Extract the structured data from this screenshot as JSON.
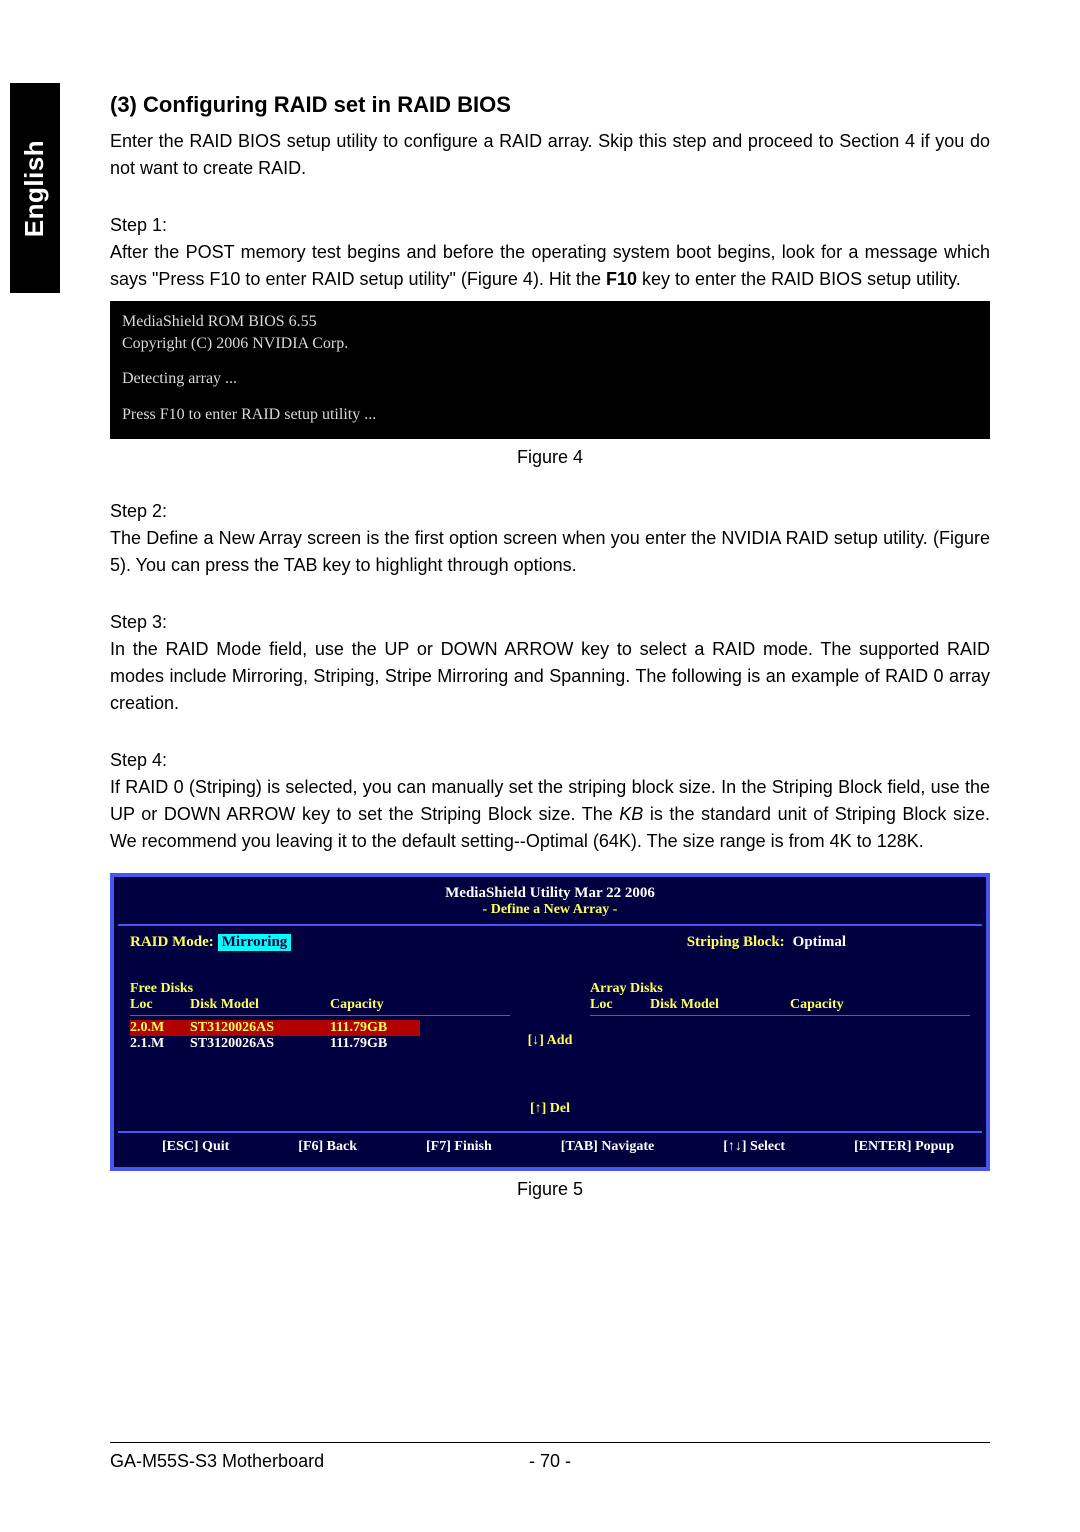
{
  "side_tab": "English",
  "section": {
    "heading": "(3) Configuring RAID set in RAID BIOS",
    "intro": "Enter the RAID BIOS setup utility to configure a RAID array. Skip this step and proceed to Section 4 if you do not want to create RAID."
  },
  "step1": {
    "label": "Step 1:",
    "text_a": "After the POST memory test begins and before the operating system boot begins, look for a message which says \"Press F10 to enter RAID setup utility\" (Figure 4). Hit the ",
    "key": "F10",
    "text_b": " key to enter the RAID BIOS setup utility."
  },
  "fig4": {
    "l1": "MediaShield ROM BIOS 6.55",
    "l2": "Copyright (C) 2006 NVIDIA Corp.",
    "l3": "Detecting array ...",
    "l4": "Press F10 to enter RAID setup utility ...",
    "caption": "Figure 4"
  },
  "step2": {
    "label": "Step 2:",
    "text": "The Define a New Array screen is the first option screen when you enter the NVIDIA RAID setup utility. (Figure 5). You can press the TAB key to highlight through options."
  },
  "step3": {
    "label": "Step 3:",
    "text": "In the RAID Mode field, use the UP or DOWN ARROW key to select a RAID mode. The supported RAID modes include Mirroring, Striping, Stripe Mirroring and Spanning. The following is an example of RAID 0 array creation."
  },
  "step4": {
    "label": "Step 4:",
    "text_a": "If RAID 0 (Striping) is selected, you can manually set the striping block size. In the Striping Block field, use the UP or DOWN ARROW key to set the Striping Block size. The ",
    "kb": "KB",
    "text_b": " is the standard unit of Striping Block size.  We recommend you leaving it to the default setting--Optimal (64K). The size range is from 4K to 128K."
  },
  "fig5": {
    "title": "MediaShield Utility  Mar  22 2006",
    "subtitle": "- Define a New Array -",
    "raid_mode_label": "RAID Mode:",
    "raid_mode_value": "Mirroring",
    "striping_label": "Striping Block:",
    "striping_value": "Optimal",
    "free_disks_title": "Free Disks",
    "array_disks_title": "Array Disks",
    "col_loc": "Loc",
    "col_model": "Disk Model",
    "col_cap": "Capacity",
    "rows": [
      {
        "loc": "2.0.M",
        "model": "ST3120026AS",
        "cap": "111.79GB",
        "selected": true
      },
      {
        "loc": "2.1.M",
        "model": "ST3120026AS",
        "cap": "111.79GB",
        "selected": false
      }
    ],
    "add_btn": "[↓]  Add",
    "del_btn": "[↑]  Del",
    "footer": {
      "esc": "[ESC] Quit",
      "f6": "[F6] Back",
      "f7": "[F7] Finish",
      "tab": "[TAB] Navigate",
      "arrows": "[↑↓] Select",
      "enter": "[ENTER] Popup"
    },
    "caption": "Figure 5"
  },
  "footer": {
    "left": "GA-M55S-S3 Motherboard",
    "page": "- 70 -"
  }
}
